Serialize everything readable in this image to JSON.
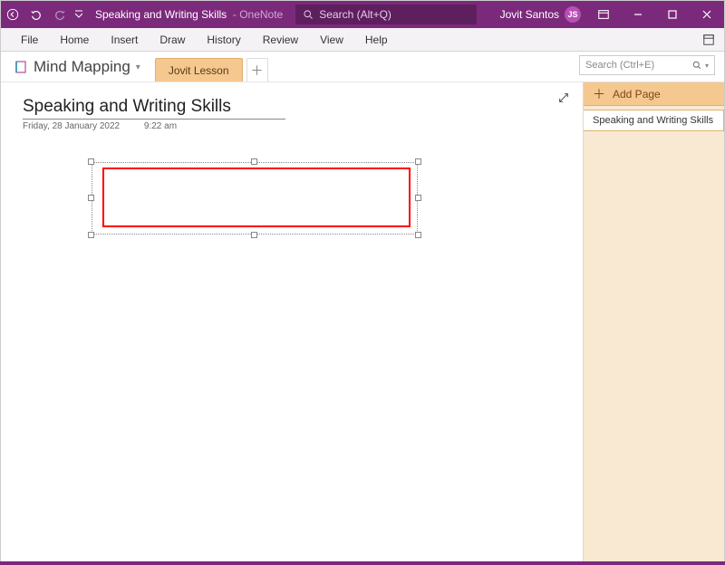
{
  "titlebar": {
    "doc_name": "Speaking and Writing Skills",
    "app_name": "OneNote",
    "search_placeholder": "Search (Alt+Q)",
    "user_name": "Jovit Santos",
    "user_initials": "JS"
  },
  "ribbon": {
    "items": [
      "File",
      "Home",
      "Insert",
      "Draw",
      "History",
      "Review",
      "View",
      "Help"
    ]
  },
  "notebook": {
    "name": "Mind Mapping",
    "sections": [
      "Jovit Lesson"
    ],
    "section_search_placeholder": "Search (Ctrl+E)"
  },
  "page": {
    "title": "Speaking and Writing Skills",
    "date": "Friday, 28 January 2022",
    "time": "9:22 am"
  },
  "pagepane": {
    "add_label": "Add Page",
    "pages": [
      "Speaking and Writing Skills"
    ]
  }
}
